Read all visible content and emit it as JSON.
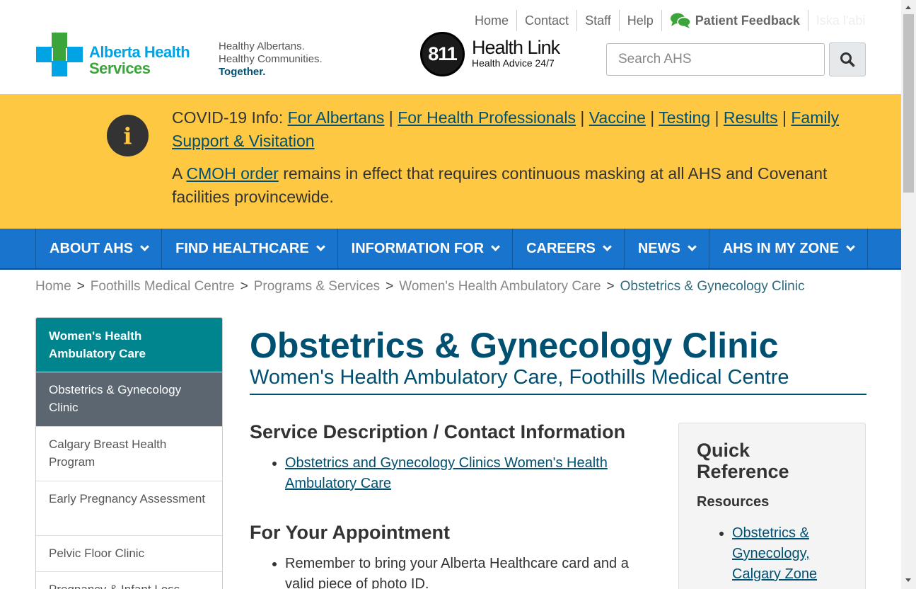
{
  "header": {
    "logo": {
      "line1": "Alberta Health",
      "line2": "Services"
    },
    "tagline": {
      "line1": "Healthy Albertans.",
      "line2": "Healthy Communities.",
      "line3": "Together."
    },
    "healthlink": {
      "number": "811",
      "title": "Health Link",
      "subtitle": "Health Advice 24/7"
    },
    "utility": {
      "home": "Home",
      "contact": "Contact",
      "staff": "Staff",
      "help": "Help",
      "patient_feedback": "Patient Feedback",
      "language": "Iska l'abi"
    },
    "search": {
      "placeholder": "Search AHS",
      "icon": "search-icon"
    }
  },
  "alert": {
    "icon": "info-icon",
    "prefix": "COVID-19 Info: ",
    "links": [
      "For Albertans",
      "For Health Professionals",
      "Vaccine",
      "Testing",
      "Results",
      "Family Support & Visitation"
    ],
    "separator": " | ",
    "p2_prefix": "A ",
    "p2_link": "CMOH order",
    "p2_text": " remains in effect that requires continuous masking at all AHS and Covenant facilities provincewide.",
    "background": "#fec843"
  },
  "nav": {
    "items": [
      "ABOUT AHS",
      "FIND HEALTHCARE",
      "INFORMATION FOR",
      "CAREERS",
      "NEWS",
      "AHS IN MY ZONE"
    ]
  },
  "breadcrumb": {
    "items": [
      "Home",
      "Foothills Medical Centre",
      "Programs & Services",
      "Women's Health Ambulatory Care"
    ],
    "current": "Obstetrics & Gynecology Clinic",
    "separator": ">"
  },
  "sidebar": {
    "heading": "Women's Health Ambulatory Care",
    "active": "Obstetrics & Gynecology Clinic",
    "items": [
      "Calgary Breast Health Program",
      "Early Pregnancy Assessment",
      "Pelvic Floor Clinic",
      "Pregnancy & Infant Loss"
    ]
  },
  "main": {
    "title": "Obstetrics & Gynecology Clinic",
    "subtitle": "Women's Health Ambulatory Care, Foothills Medical Centre",
    "service_heading": "Service Description / Contact Information",
    "service_link": "Obstetrics and Gynecology Clinics Women's Health Ambulatory Care",
    "appointment_heading": "For Your Appointment",
    "appointment_items": [
      "Remember to bring your Alberta Healthcare card and a valid piece of photo ID."
    ]
  },
  "quick_reference": {
    "title": "Quick Reference",
    "resources_label": "Resources",
    "resource_link": "Obstetrics & Gynecology, Calgary Zone"
  },
  "colors": {
    "brand_blue": "#00a4e4",
    "brand_green": "#3ba53b",
    "nav_blue": "#1874cd",
    "teal": "#00848e",
    "heading_blue": "#005072"
  }
}
